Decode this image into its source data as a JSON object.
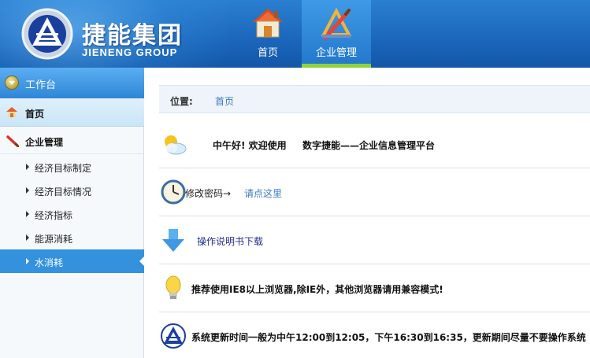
{
  "header": {
    "brand_cn": "捷能集团",
    "brand_en": "JIENENG GROUP",
    "nav": [
      {
        "label": "首页",
        "icon": "house-icon",
        "active": false
      },
      {
        "label": "企业管理",
        "icon": "tools-icon",
        "active": true
      }
    ],
    "colors": {
      "bar": "#1c68bd",
      "active_underline": "#8ed23e"
    }
  },
  "sidebar": {
    "workbench_label": "工作台",
    "home_label": "首页",
    "biz_label": "企业管理",
    "sub_items": [
      {
        "label": "经济目标制定",
        "active": false
      },
      {
        "label": "经济目标情况",
        "active": false
      },
      {
        "label": "经济指标",
        "active": false
      },
      {
        "label": "能源消耗",
        "active": false
      },
      {
        "label": "水消耗",
        "active": true
      }
    ],
    "colors": {
      "active": "#3391dd"
    }
  },
  "main": {
    "breadcrumb": {
      "label": "位置:",
      "home": "首页"
    },
    "greeting": {
      "hello": "中午好! 欢迎使用",
      "platform": "数字捷能——企业信息管理平台"
    },
    "password": {
      "label": "修改密码→",
      "link": "请点这里"
    },
    "manual": {
      "link": "操作说明书下载"
    },
    "tip": {
      "text": "推荐使用IE8以上浏览器,除IE外，其他浏览器请用兼容模式!"
    },
    "notice": {
      "text": "系统更新时间一般为中午12:00到12:05，下午16:30到16:35，更新期间尽量不要操作系统"
    }
  }
}
